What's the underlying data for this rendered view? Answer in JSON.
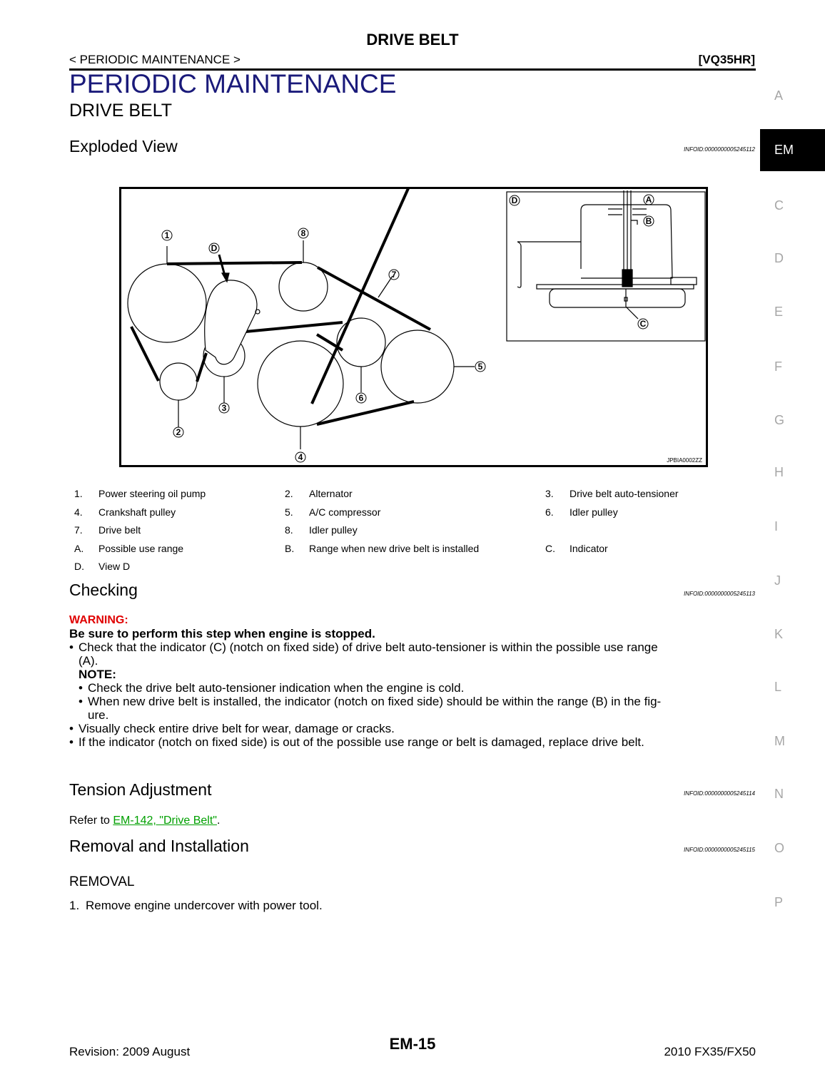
{
  "header": {
    "doc_title": "DRIVE BELT",
    "breadcrumb": "< PERIODIC MAINTENANCE >",
    "engine_code": "[VQ35HR]"
  },
  "section_title": "PERIODIC MAINTENANCE",
  "subsection_title": "DRIVE BELT",
  "side_tabs": [
    "A",
    "EM",
    "C",
    "D",
    "E",
    "F",
    "G",
    "H",
    "I",
    "J",
    "K",
    "L",
    "M",
    "N",
    "O",
    "P"
  ],
  "active_tab": "EM",
  "exploded_view": {
    "heading": "Exploded View",
    "infoid": "INFOID:0000000005245112",
    "figure": {
      "callouts": [
        "1",
        "2",
        "3",
        "4",
        "5",
        "6",
        "7",
        "8",
        "D"
      ],
      "detail_view": {
        "label": "D",
        "callouts": [
          "A",
          "B",
          "C"
        ]
      },
      "figure_code": "JPBIA0002ZZ"
    },
    "legend": [
      [
        {
          "k": "1.",
          "v": "Power steering oil pump"
        },
        {
          "k": "2.",
          "v": "Alternator"
        },
        {
          "k": "3.",
          "v": "Drive belt auto-tensioner"
        }
      ],
      [
        {
          "k": "4.",
          "v": "Crankshaft pulley"
        },
        {
          "k": "5.",
          "v": "A/C compressor"
        },
        {
          "k": "6.",
          "v": "Idler pulley"
        }
      ],
      [
        {
          "k": "7.",
          "v": "Drive belt"
        },
        {
          "k": "8.",
          "v": "Idler pulley"
        },
        {
          "k": "",
          "v": ""
        }
      ],
      [
        {
          "k": "A.",
          "v": "Possible use range"
        },
        {
          "k": "B.",
          "v": "Range when new drive belt is installed"
        },
        {
          "k": "C.",
          "v": "Indicator"
        }
      ],
      [
        {
          "k": "D.",
          "v": "View D"
        },
        {
          "k": "",
          "v": ""
        },
        {
          "k": "",
          "v": ""
        }
      ]
    ]
  },
  "checking": {
    "heading": "Checking",
    "infoid": "INFOID:0000000005245113",
    "warning_label": "WARNING:",
    "warning_text": "Be sure to perform this step when engine is stopped.",
    "bullet1_line1": "Check that the indicator (C) (notch on fixed side) of drive belt auto-tensioner is within the possible use range",
    "bullet1_line2": "(A).",
    "note_label": "NOTE:",
    "note1": "Check the drive belt auto-tensioner indication when the engine is cold.",
    "note2_line1": "When new drive belt is installed, the indicator (notch on fixed side) should be within the range (B) in the fig-",
    "note2_line2": "ure.",
    "bullet2": "Visually check entire drive belt for wear, damage or cracks.",
    "bullet3": "If the indicator (notch on fixed side) is out of the possible use range or belt is damaged, replace drive belt."
  },
  "tension": {
    "heading": "Tension  Adjustment",
    "infoid": "INFOID:0000000005245114",
    "refer_prefix": "Refer to ",
    "link_text": "EM-142, \"Drive Belt\"",
    "refer_suffix": "."
  },
  "removal": {
    "heading": "Removal and Installation",
    "infoid": "INFOID:0000000005245115",
    "sub_heading": "REMOVAL",
    "step1_num": "1.",
    "step1": "Remove engine undercover with power tool."
  },
  "footer": {
    "revision": "Revision: 2009 August",
    "page": "EM-15",
    "model": "2010 FX35/FX50"
  },
  "colors": {
    "section_title": "#1a1a7a",
    "warning": "#e00000",
    "link": "#00a000",
    "tab_inactive": "#a6a6a6",
    "tab_active_bg": "#000000"
  }
}
